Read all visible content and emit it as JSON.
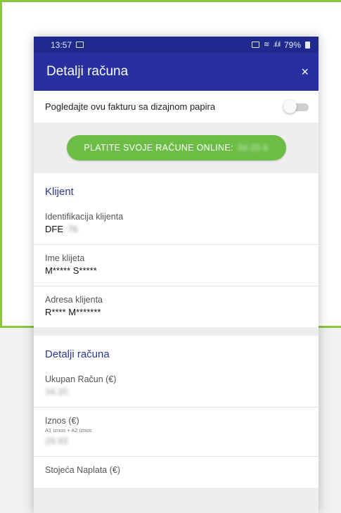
{
  "status_bar": {
    "time": "13:57",
    "battery": "79%"
  },
  "app_bar": {
    "title": "Detalji računa",
    "close_glyph": "×"
  },
  "paper_toggle": {
    "label": "Pogledajte ovu fakturu sa dizajnom papira",
    "checked": false
  },
  "pay_button": {
    "label": "PLATITE SVOJE RAČUNE ONLINE:",
    "amount_blurred": "34.20 €"
  },
  "client_section": {
    "title": "Klijent",
    "fields": [
      {
        "label": "Identifikacija klijenta",
        "value": "DFE",
        "masked_suffix": "76"
      },
      {
        "label": "Ime klijeta",
        "value": "M***** S*****"
      },
      {
        "label": "Adresa klijenta",
        "value": "R**** M*******"
      }
    ]
  },
  "bill_section": {
    "title": "Detalji računa",
    "fields": [
      {
        "label": "Ukupan Račun (€)",
        "value": "34.20"
      },
      {
        "label": "Iznos (€)",
        "sub": "A1 Iznos + A2 Iznos",
        "value": "29.93"
      },
      {
        "label": "Stojeća Naplata (€)"
      }
    ]
  },
  "colors": {
    "accent_green": "#8cc63f",
    "app_bar": "#2630a0",
    "pay_button": "#6bbd45",
    "section_title": "#2c3594"
  }
}
